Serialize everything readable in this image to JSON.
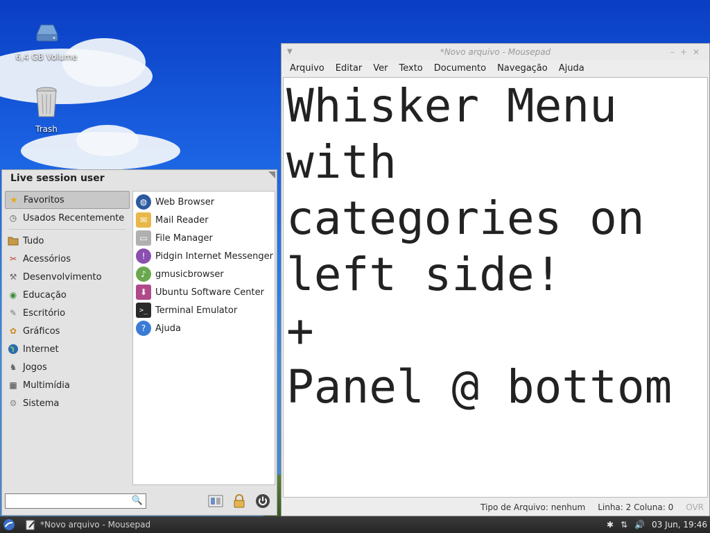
{
  "desktop": {
    "icons": [
      {
        "label": "6,4 GB Volume",
        "icon": "drive-icon"
      },
      {
        "label": "Trash",
        "icon": "trash-icon"
      }
    ]
  },
  "window": {
    "title": "*Novo arquivo - Mousepad",
    "menu": [
      "Arquivo",
      "Editar",
      "Ver",
      "Texto",
      "Documento",
      "Navegação",
      "Ajuda"
    ],
    "content": "Whisker Menu\nwith\ncategories on\nleft side!\n+\nPanel @ bottom",
    "status": {
      "filetype": "Tipo de Arquivo: nenhum",
      "position": "Linha: 2 Coluna: 0",
      "mode": "OVR"
    }
  },
  "whisker": {
    "user": "Live session user",
    "categories": [
      {
        "label": "Favoritos",
        "icon": "star-icon",
        "selected": true
      },
      {
        "label": "Usados Recentemente",
        "icon": "clock-icon"
      },
      {
        "label": "Tudo",
        "icon": "folder-icon"
      },
      {
        "label": "Acessórios",
        "icon": "accessories-icon"
      },
      {
        "label": "Desenvolvimento",
        "icon": "development-icon"
      },
      {
        "label": "Educação",
        "icon": "education-icon"
      },
      {
        "label": "Escritório",
        "icon": "office-icon"
      },
      {
        "label": "Gráficos",
        "icon": "graphics-icon"
      },
      {
        "label": "Internet",
        "icon": "globe-icon"
      },
      {
        "label": "Jogos",
        "icon": "games-icon"
      },
      {
        "label": "Multimídia",
        "icon": "multimedia-icon"
      },
      {
        "label": "Sistema",
        "icon": "system-icon"
      }
    ],
    "apps": [
      {
        "label": "Web Browser",
        "icon": "web-browser-icon",
        "color": "#2c5aa0"
      },
      {
        "label": "Mail Reader",
        "icon": "mail-icon",
        "color": "#e8b84a"
      },
      {
        "label": "File Manager",
        "icon": "file-manager-icon",
        "color": "#b0b0b0"
      },
      {
        "label": "Pidgin Internet Messenger",
        "icon": "pidgin-icon",
        "color": "#8a4fb0"
      },
      {
        "label": "gmusicbrowser",
        "icon": "music-icon",
        "color": "#6aa84f"
      },
      {
        "label": "Ubuntu Software Center",
        "icon": "software-center-icon",
        "color": "#b04a8a"
      },
      {
        "label": "Terminal Emulator",
        "icon": "terminal-icon",
        "color": "#2a2a2a"
      },
      {
        "label": "Ajuda",
        "icon": "help-icon",
        "color": "#3a7bd5"
      }
    ]
  },
  "panel": {
    "task": "*Novo arquivo - Mousepad",
    "clock": "03 Jun, 19:46"
  }
}
